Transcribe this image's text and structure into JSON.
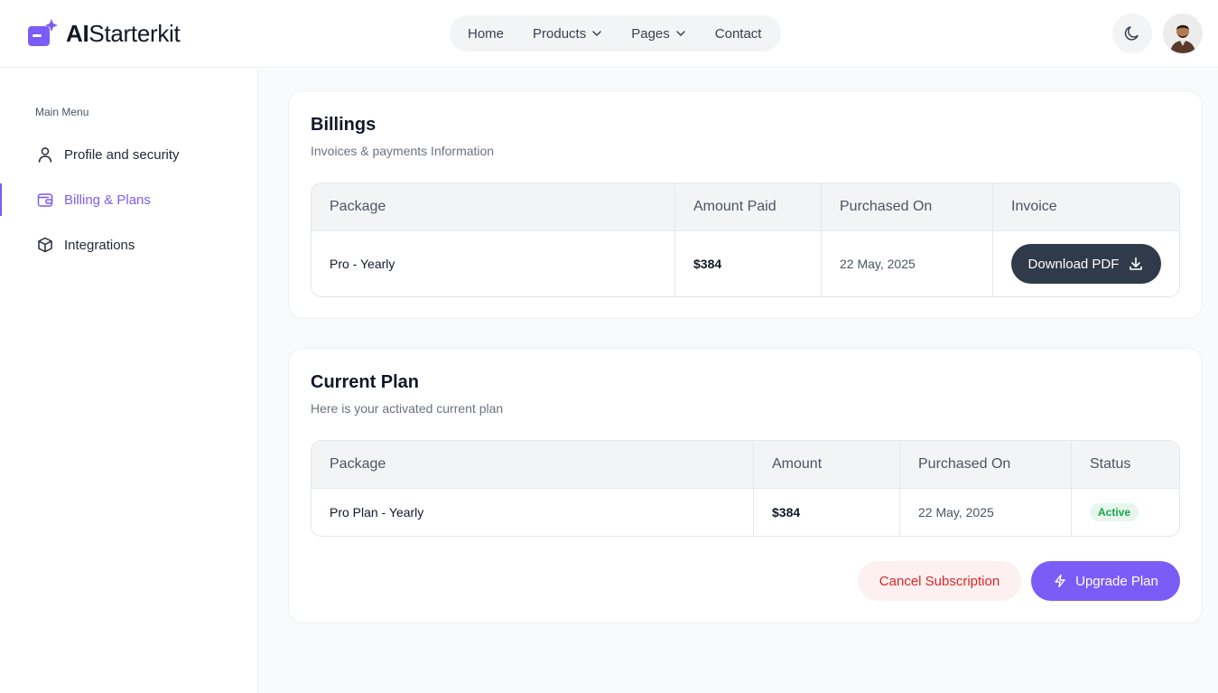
{
  "brand": {
    "ai": "AI",
    "rest": "Starterkit",
    "accent": "#7c5cf6"
  },
  "nav": {
    "home": "Home",
    "products": "Products",
    "pages": "Pages",
    "contact": "Contact"
  },
  "header": {
    "theme_icon": "moon-icon",
    "avatar": "user-avatar"
  },
  "sidebar": {
    "title": "Main Menu",
    "items": [
      {
        "label": "Profile and security",
        "icon": "user-icon"
      },
      {
        "label": "Billing & Plans",
        "icon": "wallet-icon",
        "active": true
      },
      {
        "label": "Integrations",
        "icon": "box-icon"
      }
    ]
  },
  "billings": {
    "title": "Billings",
    "subtitle": "Invoices & payments Information",
    "columns": [
      "Package",
      "Amount Paid",
      "Purchased On",
      "Invoice"
    ],
    "rows": [
      {
        "package": "Pro - Yearly",
        "amount": "$384",
        "purchased_on": "22 May, 2025",
        "invoice_label": "Download PDF"
      }
    ]
  },
  "current_plan": {
    "title": "Current Plan",
    "subtitle": "Here is your activated current plan",
    "columns": [
      "Package",
      "Amount",
      "Purchased On",
      "Status"
    ],
    "rows": [
      {
        "package": "Pro Plan - Yearly",
        "amount": "$384",
        "purchased_on": "22 May, 2025",
        "status": "Active"
      }
    ],
    "cancel_label": "Cancel Subscription",
    "upgrade_label": "Upgrade Plan"
  }
}
